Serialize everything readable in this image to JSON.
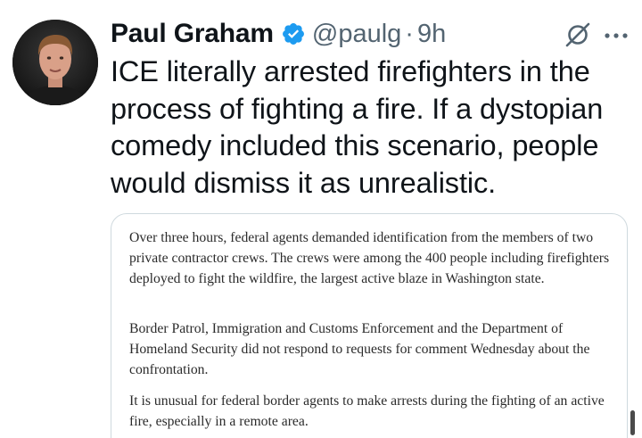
{
  "author": {
    "name": "Paul Graham",
    "handle": "@paulg",
    "separator": "·",
    "time": "9h",
    "verified_color": "#1d9bf0",
    "avatar_icon": "profile-photo"
  },
  "tweet": {
    "text": "ICE literally arrested firefighters in the process of fighting a fire. If a dystopian comedy included this scenario, people would dismiss it as unrealistic."
  },
  "quote": {
    "paragraphs": [
      "Over three hours, federal agents demanded identification from the members of two private contractor crews. The crews were among the 400 people including firefighters deployed to fight the wildfire, the largest active blaze in Washington state.",
      "Border Patrol, Immigration and Customs Enforcement and the Department of Homeland Security did not respond to requests for comment Wednesday about the confrontation.",
      "It is unusual for federal border agents to make arrests during the fighting of an active fire, especially in a remote area."
    ]
  },
  "icons": {
    "verified": "verified-badge-icon",
    "grok": "grok-icon",
    "more": "more-options-icon"
  },
  "colors": {
    "text_primary": "#0f1419",
    "text_secondary": "#536471",
    "border": "#cfd9de",
    "accent": "#1d9bf0"
  }
}
